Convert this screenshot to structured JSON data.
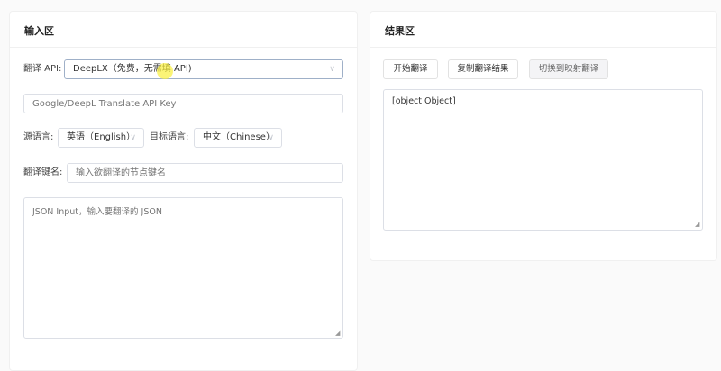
{
  "input_panel": {
    "title": "输入区",
    "api_label": "翻译 API:",
    "api_value": "DeepLX（免费，无需填 API)",
    "api_key_placeholder": "Google/DeepL Translate API Key",
    "source_label": "源语言:",
    "source_value": "英语（English）",
    "target_label": "目标语言:",
    "target_value": "中文（Chinese）",
    "key_label": "翻译键名:",
    "key_placeholder": "输入欲翻译的节点键名",
    "json_placeholder": "JSON Input，输入要翻译的 JSON"
  },
  "result_panel": {
    "title": "结果区",
    "buttons": [
      "开始翻译",
      "复制翻译结果",
      "切换到映射翻译"
    ],
    "output_value": "[object Object]"
  },
  "icons": {
    "dropdown": "chevron-down-icon"
  }
}
